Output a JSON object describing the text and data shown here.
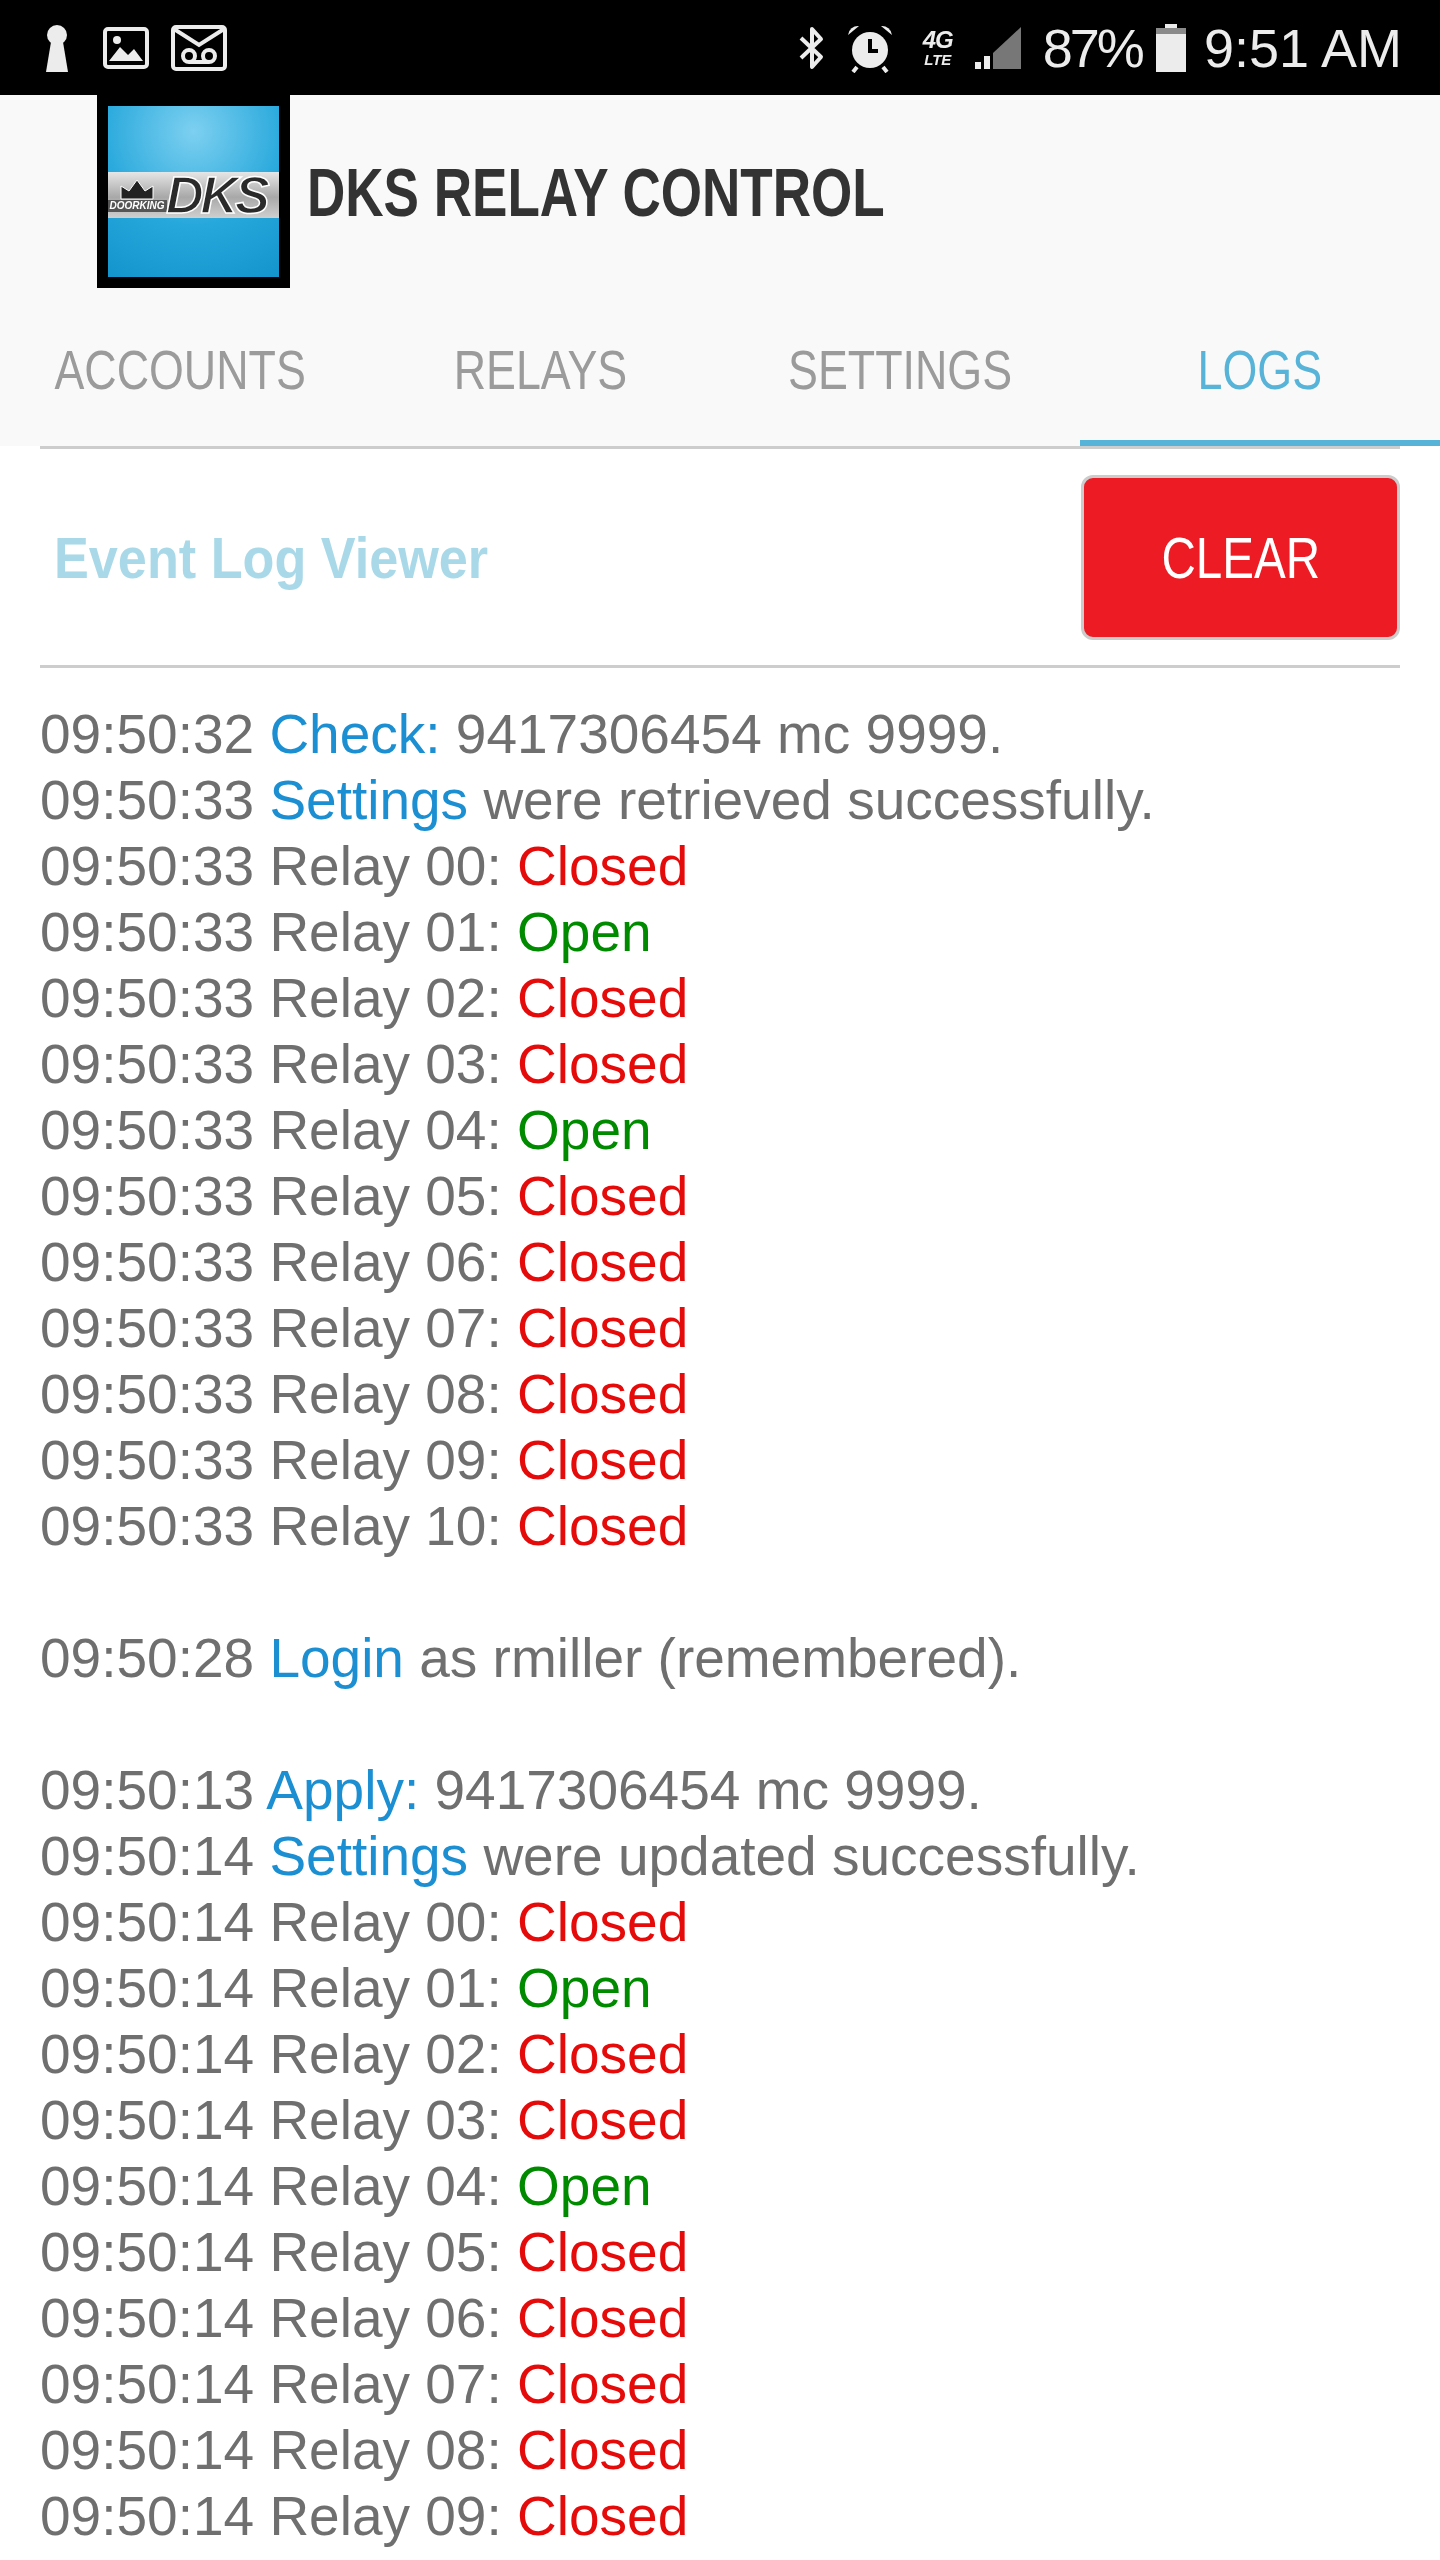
{
  "status_bar": {
    "network": "4G",
    "network_sub": "LTE",
    "battery": "87%",
    "time": "9:51 AM"
  },
  "header": {
    "logo": {
      "wordmark": "DKS",
      "tagline": "DOORKING"
    },
    "title": "DKS RELAY CONTROL"
  },
  "tabs": [
    {
      "label": "ACCOUNTS",
      "selected": false
    },
    {
      "label": "RELAYS",
      "selected": false
    },
    {
      "label": "SETTINGS",
      "selected": false
    },
    {
      "label": "LOGS",
      "selected": true
    }
  ],
  "log_viewer": {
    "title": "Event Log Viewer",
    "clear_button": "CLEAR",
    "groups": [
      {
        "entries": [
          {
            "kind": "event",
            "time": "09:50:32",
            "keyword": "Check:",
            "text": "9417306454 mc 9999."
          },
          {
            "kind": "event",
            "time": "09:50:33",
            "keyword": "Settings",
            "text": "were retrieved successfully."
          },
          {
            "kind": "relay",
            "time": "09:50:33",
            "relay": "Relay 00:",
            "status": "Closed",
            "open": false
          },
          {
            "kind": "relay",
            "time": "09:50:33",
            "relay": "Relay 01:",
            "status": "Open",
            "open": true
          },
          {
            "kind": "relay",
            "time": "09:50:33",
            "relay": "Relay 02:",
            "status": "Closed",
            "open": false
          },
          {
            "kind": "relay",
            "time": "09:50:33",
            "relay": "Relay 03:",
            "status": "Closed",
            "open": false
          },
          {
            "kind": "relay",
            "time": "09:50:33",
            "relay": "Relay 04:",
            "status": "Open",
            "open": true
          },
          {
            "kind": "relay",
            "time": "09:50:33",
            "relay": "Relay 05:",
            "status": "Closed",
            "open": false
          },
          {
            "kind": "relay",
            "time": "09:50:33",
            "relay": "Relay 06:",
            "status": "Closed",
            "open": false
          },
          {
            "kind": "relay",
            "time": "09:50:33",
            "relay": "Relay 07:",
            "status": "Closed",
            "open": false
          },
          {
            "kind": "relay",
            "time": "09:50:33",
            "relay": "Relay 08:",
            "status": "Closed",
            "open": false
          },
          {
            "kind": "relay",
            "time": "09:50:33",
            "relay": "Relay 09:",
            "status": "Closed",
            "open": false
          },
          {
            "kind": "relay",
            "time": "09:50:33",
            "relay": "Relay 10:",
            "status": "Closed",
            "open": false
          }
        ]
      },
      {
        "entries": [
          {
            "kind": "event",
            "time": "09:50:28",
            "keyword": "Login",
            "text": "as rmiller (remembered)."
          }
        ]
      },
      {
        "entries": [
          {
            "kind": "event",
            "time": "09:50:13",
            "keyword": "Apply:",
            "text": "9417306454 mc 9999."
          },
          {
            "kind": "event",
            "time": "09:50:14",
            "keyword": "Settings",
            "text": "were updated successfully."
          },
          {
            "kind": "relay",
            "time": "09:50:14",
            "relay": "Relay 00:",
            "status": "Closed",
            "open": false
          },
          {
            "kind": "relay",
            "time": "09:50:14",
            "relay": "Relay 01:",
            "status": "Open",
            "open": true
          },
          {
            "kind": "relay",
            "time": "09:50:14",
            "relay": "Relay 02:",
            "status": "Closed",
            "open": false
          },
          {
            "kind": "relay",
            "time": "09:50:14",
            "relay": "Relay 03:",
            "status": "Closed",
            "open": false
          },
          {
            "kind": "relay",
            "time": "09:50:14",
            "relay": "Relay 04:",
            "status": "Open",
            "open": true
          },
          {
            "kind": "relay",
            "time": "09:50:14",
            "relay": "Relay 05:",
            "status": "Closed",
            "open": false
          },
          {
            "kind": "relay",
            "time": "09:50:14",
            "relay": "Relay 06:",
            "status": "Closed",
            "open": false
          },
          {
            "kind": "relay",
            "time": "09:50:14",
            "relay": "Relay 07:",
            "status": "Closed",
            "open": false
          },
          {
            "kind": "relay",
            "time": "09:50:14",
            "relay": "Relay 08:",
            "status": "Closed",
            "open": false
          },
          {
            "kind": "relay",
            "time": "09:50:14",
            "relay": "Relay 09:",
            "status": "Closed",
            "open": false
          }
        ]
      }
    ]
  }
}
